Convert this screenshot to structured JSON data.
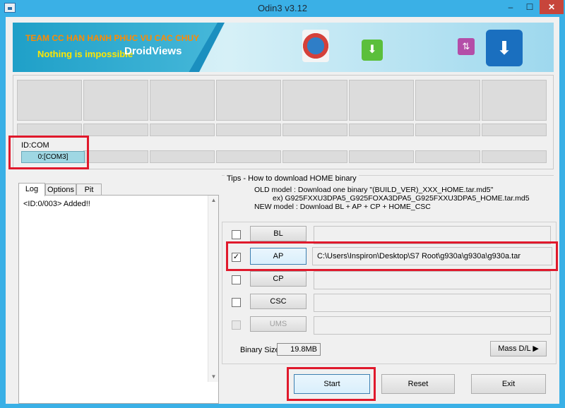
{
  "window": {
    "title": "Odin3 v3.12",
    "minimize": "–",
    "maximize": "☐",
    "close": "✕"
  },
  "banner": {
    "line1": "TEAM CC HAN HANH PHUC VU CAC CHUY",
    "line2": "Nothing is impossible",
    "watermark": "DroidViews"
  },
  "idcom": {
    "label": "ID:COM",
    "active_port": "0:[COM3]"
  },
  "tabs": [
    "Log",
    "Options",
    "Pit"
  ],
  "log": {
    "lines": [
      "<ID:0/003> Added!!"
    ]
  },
  "tips": {
    "title": "Tips - How to download HOME binary",
    "line1": "OLD model  : Download one binary    \"(BUILD_VER)_XXX_HOME.tar.md5\"",
    "line2": "ex) G925FXXU3DPA5_G925FOXA3DPA5_G925FXXU3DPA5_HOME.tar.md5",
    "line3": "NEW model : Download BL + AP + CP + HOME_CSC"
  },
  "files": [
    {
      "label": "BL",
      "checked": false,
      "path": "",
      "enabled": true
    },
    {
      "label": "AP",
      "checked": true,
      "path": "C:\\Users\\Inspiron\\Desktop\\S7 Root\\g930a\\g930a\\g930a.tar",
      "enabled": true
    },
    {
      "label": "CP",
      "checked": false,
      "path": "",
      "enabled": true
    },
    {
      "label": "CSC",
      "checked": false,
      "path": "",
      "enabled": true
    },
    {
      "label": "UMS",
      "checked": false,
      "path": "",
      "enabled": false
    }
  ],
  "binary": {
    "label": "Binary Size",
    "value": "19.8MB"
  },
  "mass_dl": "Mass D/L ▶",
  "actions": {
    "start": "Start",
    "reset": "Reset",
    "exit": "Exit"
  },
  "colors": {
    "titlebar": "#3ab0e6",
    "highlight": "#e0192c",
    "com_active": "#9fd7e3"
  }
}
